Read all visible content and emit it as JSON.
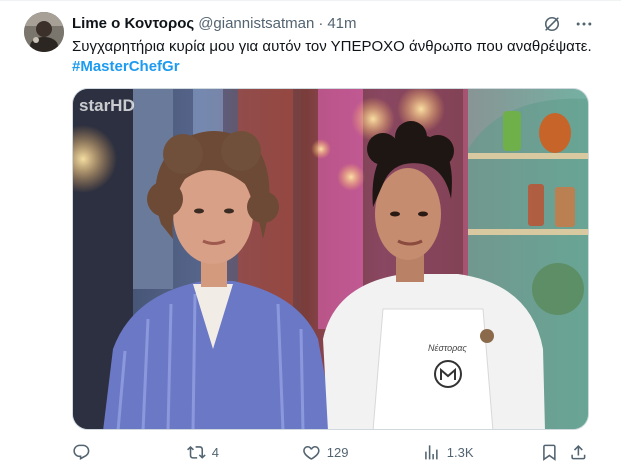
{
  "tweet": {
    "author_name": "Lime ο Κοντορος",
    "handle": "@giannistsatman",
    "separator": "·",
    "time": "41m",
    "text": "Συγχαρητήρια κυρία μου για αυτόν τον ΥΠΕΡΟΧΟ άνθρωπο που αναθρέψατε.",
    "hashtag": "#MasterChefGr",
    "media": {
      "channel_logo": "starHD",
      "apron_name": "Νέστορας"
    },
    "actions": {
      "reply_count": "",
      "retweet_count": "4",
      "like_count": "129",
      "views_count": "1.3K"
    }
  },
  "icons": {
    "grok": "grok-icon",
    "more": "more-icon",
    "reply": "reply-icon",
    "retweet": "retweet-icon",
    "like": "heart-icon",
    "views": "views-icon",
    "bookmark": "bookmark-icon",
    "share": "share-icon"
  },
  "colors": {
    "text": "#0f1419",
    "secondary": "#536471",
    "link": "#1d9bf0",
    "border": "#cfd9de"
  }
}
